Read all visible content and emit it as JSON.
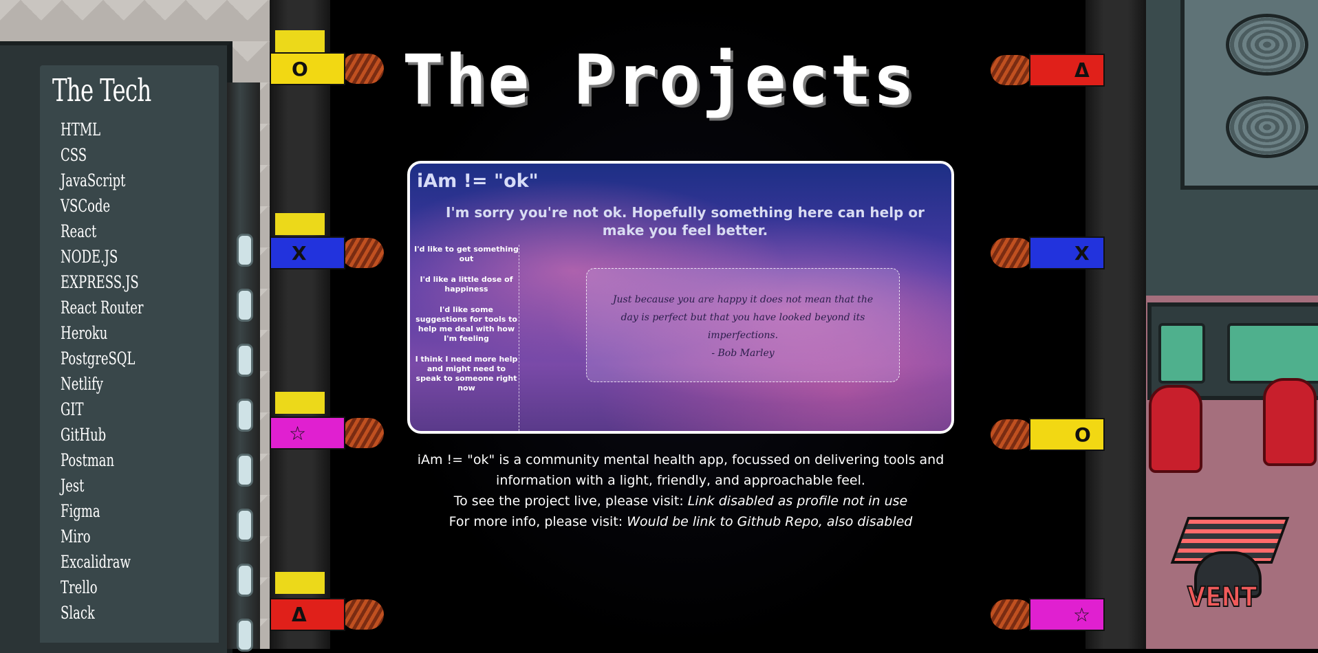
{
  "sidebar": {
    "title": "The Tech",
    "items": [
      "HTML",
      "CSS",
      "JavaScript",
      "VSCode",
      "React",
      "NODE.JS",
      "EXPRESS.JS",
      "React Router",
      "Heroku",
      "PostgreSQL",
      "Netlify",
      "GIT",
      "GitHub",
      "Postman",
      "Jest",
      "Figma",
      "Miro",
      "Excalidraw",
      "Trello",
      "Slack"
    ]
  },
  "page": {
    "title": "The Projects"
  },
  "project": {
    "app_title": "iAm != \"ok\"",
    "app_subtitle": "I'm sorry you're not ok. Hopefully something here can help or make you feel better.",
    "menu": [
      "I'd like to get something out",
      "I'd like a little dose of happiness",
      "I'd like some suggestions for tools to help me deal with how I'm feeling",
      "I think I need more help and might need to speak to someone right now"
    ],
    "quote": "Just because you are happy it does not mean that the day is perfect but that you have looked beyond its imperfections.",
    "quote_author": "- Bob Marley",
    "description_1": "iAm != \"ok\" is a community mental health app, focussed on delivering tools and information with a light, friendly, and approachable feel.",
    "live_label": "To see the project live, please visit:",
    "live_link": "Link disabled as profile not in use",
    "info_label": "For more info, please visit:",
    "info_link": "Would be link to Github Repo, also disabled"
  },
  "decor": {
    "vent_label": "VENT",
    "wire_symbols": [
      "O",
      "X",
      "☆",
      "Δ",
      "Δ",
      "X",
      "O",
      "☆"
    ]
  },
  "colors": {
    "wire_yellow": "#f2d813",
    "wire_blue": "#2233dd",
    "wire_magenta": "#e020d0",
    "wire_red": "#e0201a",
    "vent_red": "#f05a5a"
  }
}
